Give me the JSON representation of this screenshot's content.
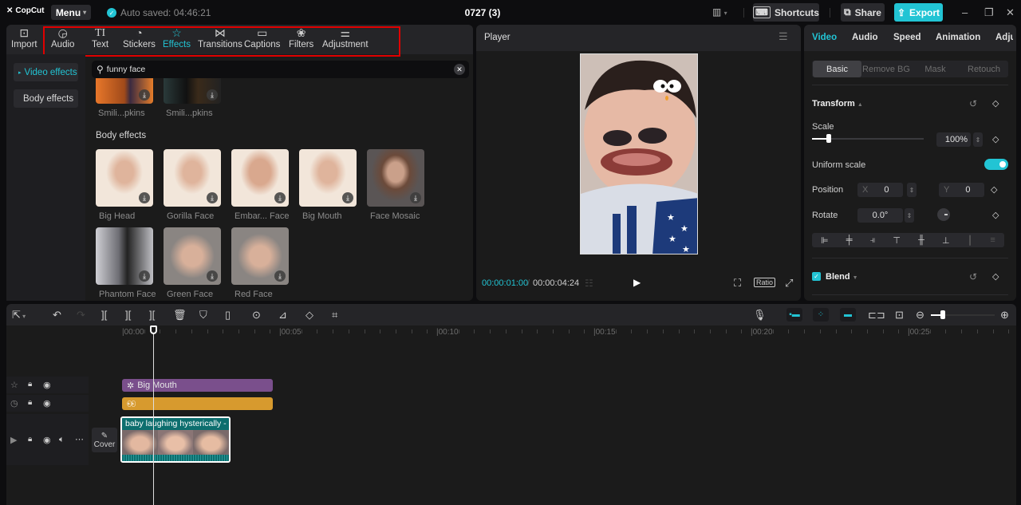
{
  "app": {
    "logo": "CopCut",
    "menu_label": "Menu",
    "autosave": "Auto saved: 04:46:21",
    "project_title": "0727 (3)"
  },
  "header_buttons": {
    "shortcuts": "Shortcuts",
    "share": "Share",
    "export": "Export"
  },
  "toolbar_tabs": [
    {
      "label": "Import",
      "icon": "import-icon"
    },
    {
      "label": "Audio",
      "icon": "audio-icon"
    },
    {
      "label": "Text",
      "icon": "text-icon"
    },
    {
      "label": "Stickers",
      "icon": "stickers-icon"
    },
    {
      "label": "Effects",
      "icon": "effects-icon",
      "active": true
    },
    {
      "label": "Transitions",
      "icon": "transitions-icon"
    },
    {
      "label": "Captions",
      "icon": "captions-icon"
    },
    {
      "label": "Filters",
      "icon": "filters-icon"
    },
    {
      "label": "Adjustment",
      "icon": "adjustment-icon"
    }
  ],
  "categories": [
    {
      "label": "Video effects",
      "active": true
    },
    {
      "label": "Body effects"
    }
  ],
  "search": {
    "value": "funny face"
  },
  "partial_results": [
    {
      "label": "Smili...pkins"
    },
    {
      "label": "Smili...pkins"
    }
  ],
  "body_effects_title": "Body effects",
  "body_effects": [
    {
      "label": "Big Head"
    },
    {
      "label": "Gorilla Face"
    },
    {
      "label": "Embar... Face"
    },
    {
      "label": "Big Mouth"
    },
    {
      "label": "Face Mosaic"
    },
    {
      "label": "Phantom Face"
    },
    {
      "label": "Green Face"
    },
    {
      "label": "Red Face"
    }
  ],
  "player": {
    "title": "Player",
    "current_time": "00:00:01:00",
    "separator": "/",
    "total_time": "00:00:04:24",
    "ratio_label": "Ratio"
  },
  "inspector": {
    "tabs": [
      {
        "label": "Video",
        "active": true
      },
      {
        "label": "Audio"
      },
      {
        "label": "Speed"
      },
      {
        "label": "Animation"
      },
      {
        "label": "Adju"
      }
    ],
    "subtabs": [
      {
        "label": "Basic",
        "active": true
      },
      {
        "label": "Remove BG"
      },
      {
        "label": "Mask"
      },
      {
        "label": "Retouch"
      }
    ],
    "transform_title": "Transform",
    "scale_label": "Scale",
    "scale_value": "100%",
    "scale_fraction": 0.15,
    "uniform_scale_label": "Uniform scale",
    "uniform_scale_on": true,
    "position_label": "Position",
    "pos_x_label": "X",
    "pos_x": "0",
    "pos_y_label": "Y",
    "pos_y": "0",
    "rotate_label": "Rotate",
    "rotate_value": "0.0°",
    "blend_label": "Blend",
    "blend_checked": true
  },
  "timeline": {
    "ruler": [
      "00:00",
      "00:05",
      "00:10",
      "00:15",
      "00:20",
      "00:25"
    ],
    "effect_clip": "Big Mouth",
    "video_clip": "baby laughing hysterically - b",
    "cover_label": "Cover"
  },
  "colors": {
    "accent": "#22c4d4",
    "effect_clip": "#7a4f8c",
    "sticker_clip": "#d79a2e",
    "highlight_box": "#e00000"
  }
}
